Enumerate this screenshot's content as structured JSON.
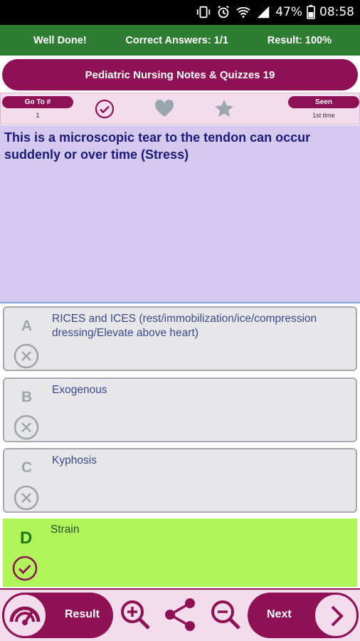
{
  "status_bar": {
    "battery": "47%",
    "time": "08:58"
  },
  "result_bar": {
    "message": "Well Done!",
    "correct_answers": "Correct Answers: 1/1",
    "result": "Result: 100%"
  },
  "title": "Pediatric Nursing Notes & Quizzes 19",
  "toolbar": {
    "goto_label": "Go To #",
    "goto_value": "1",
    "seen_label": "Seen",
    "seen_value": "1st time"
  },
  "question": "This is a microscopic tear to the tendon can occur suddenly or over time (Stress)",
  "options": [
    {
      "letter": "A",
      "text": "RICES and ICES (rest/immobilization/ice/compression dressing/Elevate above heart)",
      "state": "wrong"
    },
    {
      "letter": "B",
      "text": "Exogenous",
      "state": "wrong"
    },
    {
      "letter": "C",
      "text": "Kyphosis",
      "state": "wrong"
    },
    {
      "letter": "D",
      "text": "Strain",
      "state": "correct"
    }
  ],
  "bottom_bar": {
    "result_label": "Result",
    "next_label": "Next"
  },
  "colors": {
    "primary": "#8e1155",
    "success_bar": "#2e7d32",
    "correct_option": "#b0f55a",
    "question_bg": "#d4c8ef"
  }
}
